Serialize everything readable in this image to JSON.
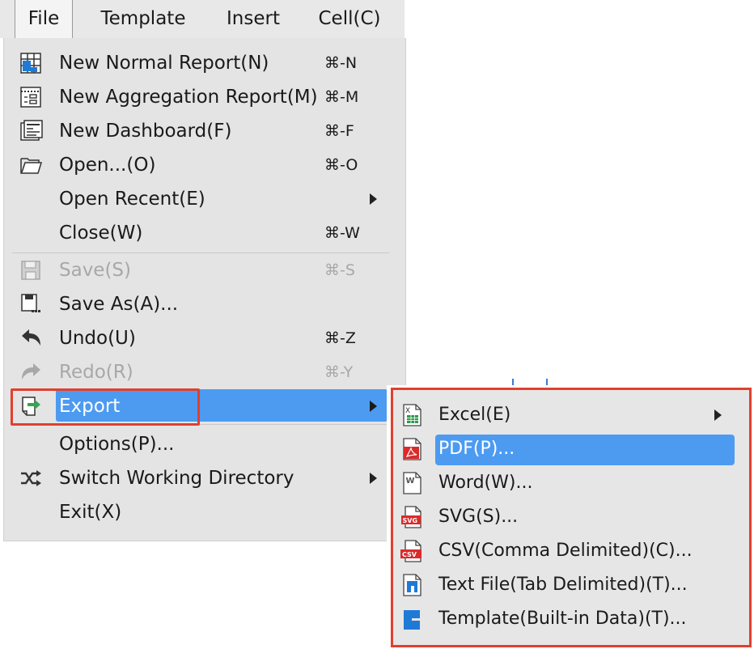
{
  "menubar": {
    "items": [
      {
        "label": "File",
        "active": true
      },
      {
        "label": "Template",
        "active": false
      },
      {
        "label": "Insert",
        "active": false
      },
      {
        "label": "Cell(C)",
        "active": false
      }
    ]
  },
  "file_menu": {
    "items": [
      {
        "label": "New Normal Report(N)",
        "shortcut": "⌘-N",
        "icon": "normal-report-icon"
      },
      {
        "label": "New Aggregation Report(M)",
        "shortcut": "⌘-M",
        "icon": "aggregation-report-icon"
      },
      {
        "label": "New Dashboard(F)",
        "shortcut": "⌘-F",
        "icon": "dashboard-icon"
      },
      {
        "label": "Open...(O)",
        "shortcut": "⌘-O",
        "icon": "folder-icon"
      },
      {
        "label": "Open Recent(E)",
        "submenu": true
      },
      {
        "label": "Close(W)",
        "shortcut": "⌘-W"
      },
      {
        "label": "Save(S)",
        "shortcut": "⌘-S",
        "icon": "save-icon",
        "disabled": true
      },
      {
        "label": "Save As(A)...",
        "icon": "save-as-icon"
      },
      {
        "label": "Undo(U)",
        "shortcut": "⌘-Z",
        "icon": "undo-icon"
      },
      {
        "label": "Redo(R)",
        "shortcut": "⌘-Y",
        "icon": "redo-icon",
        "disabled": true
      },
      {
        "label": "Export",
        "icon": "export-icon",
        "submenu": true,
        "highlighted": true
      },
      {
        "label": "Options(P)..."
      },
      {
        "label": "Switch Working Directory",
        "icon": "shuffle-icon",
        "submenu": true
      },
      {
        "label": "Exit(X)"
      }
    ]
  },
  "export_submenu": {
    "items": [
      {
        "label": "Excel(E)",
        "icon": "excel-file-icon",
        "submenu": true
      },
      {
        "label": "PDF(P)...",
        "icon": "pdf-file-icon",
        "highlighted": true
      },
      {
        "label": "Word(W)...",
        "icon": "word-file-icon"
      },
      {
        "label": "SVG(S)...",
        "icon": "svg-file-icon"
      },
      {
        "label": "CSV(Comma Delimited)(C)...",
        "icon": "csv-file-icon"
      },
      {
        "label": "Text File(Tab Delimited)(T)...",
        "icon": "text-file-icon"
      },
      {
        "label": "Template(Built-in Data)(T)...",
        "icon": "template-file-icon"
      }
    ]
  },
  "colors": {
    "highlight": "#4c9bf1",
    "annotation_box": "#e0402f",
    "menu_bg": "#e4e4e4",
    "disabled_text": "#a8a8a8"
  }
}
